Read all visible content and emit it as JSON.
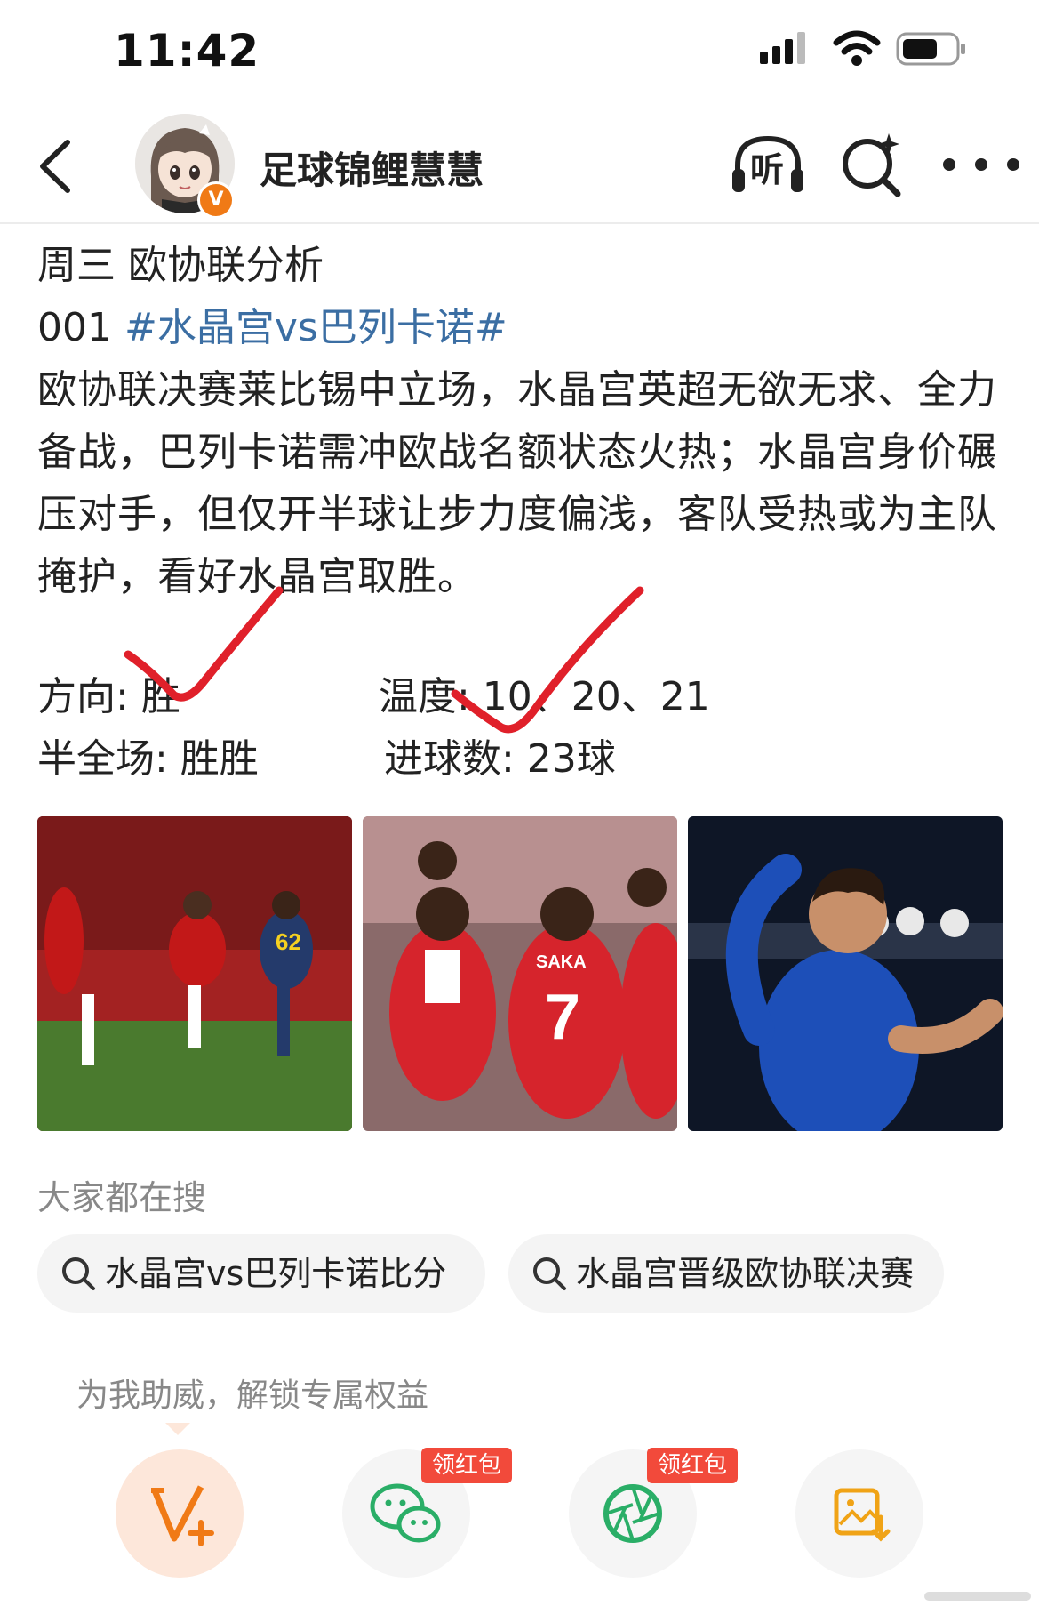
{
  "status_bar": {
    "time": "11:42"
  },
  "header": {
    "username": "足球锦鲤慧慧",
    "listen_label": "听",
    "verified_badge": "V"
  },
  "post": {
    "line1": "周三 欧协联分析",
    "match_no": "001",
    "hashtag": "#水晶宫vs巴列卡诺#",
    "paragraph": "欧协联决赛莱比锡中立场，水晶宫英超无欲无求、全力备战，巴列卡诺需冲欧战名额状态火热；水晶宫身价碾压对手，但仅开半球让步力度偏浅，客队受热或为主队掩护，看好水晶宫取胜。",
    "direction": "方向: 胜",
    "temperature": "温度: 10、20、21",
    "half_full": "半全场: 胜胜",
    "goals": "进球数: 23球"
  },
  "images": {
    "jersey_number_1": "62",
    "jersey_name_2": "SAKA",
    "jersey_number_2": "7"
  },
  "search": {
    "heading": "大家都在搜",
    "chips": [
      "水晶宫vs巴列卡诺比分",
      "水晶宫晋级欧协联决赛"
    ]
  },
  "share": {
    "prompt": "为我助威，解锁专属权益",
    "redbag_label": "领红包"
  },
  "colors": {
    "accent": "#f07a16",
    "hashtag": "#3b6ea3",
    "redbag": "#f24a3b",
    "check": "#e0202a"
  }
}
